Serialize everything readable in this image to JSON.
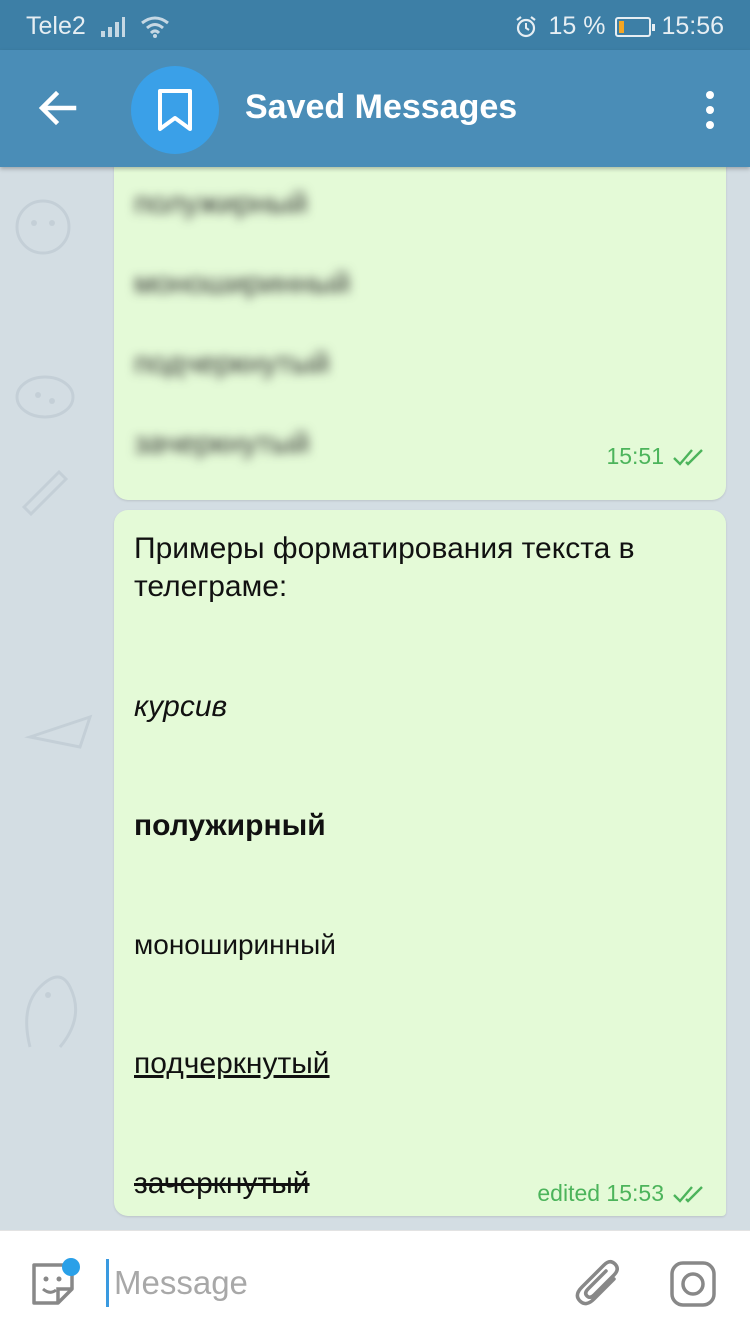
{
  "status_bar": {
    "carrier": "Tele2",
    "battery": "15 %",
    "time": "15:56",
    "battery_level": 0.15
  },
  "header": {
    "title": "Saved Messages",
    "avatar_icon": "bookmark-icon",
    "colors": {
      "header": "#4a8db7",
      "status": "#3d7fa6",
      "avatar": "#3aa0e8"
    }
  },
  "messages": [
    {
      "blurred_lines": [
        "полужирный",
        "моноширинный",
        "подчеркнутый",
        "зачеркнутый"
      ],
      "time": "15:51"
    },
    {
      "intro": "Примеры форматирования текста в телеграме:",
      "italic": "курсив",
      "bold": "полужирный",
      "mono": "моноширинный",
      "underline": "подчеркнутый",
      "strike": "зачеркнутый",
      "time": "edited 15:53"
    }
  ],
  "input": {
    "placeholder": "Message"
  }
}
